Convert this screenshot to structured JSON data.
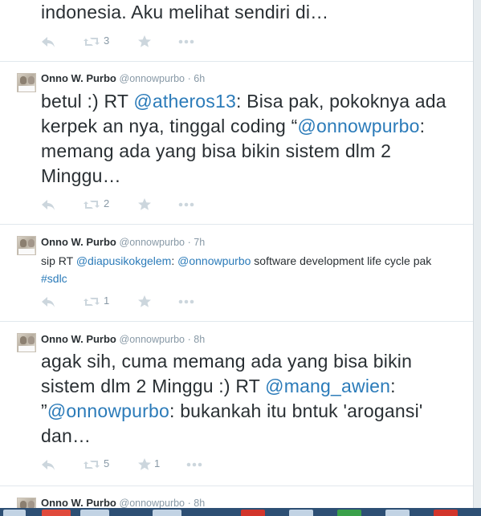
{
  "tweets": [
    {
      "text_segments": [
        {
          "text": "indonesia. Aku melihat sendiri di…",
          "link": false
        }
      ],
      "retweet_count": "3",
      "favorite_count": ""
    },
    {
      "name": "Onno W. Purbo",
      "handle": "@onnowpurbo",
      "time": "· 6h",
      "text_segments": [
        {
          "text": "betul :) RT ",
          "link": false
        },
        {
          "text": "@atheros13",
          "link": true
        },
        {
          "text": ": Bisa pak, pokoknya ada kerpek an nya, tinggal coding “",
          "link": false
        },
        {
          "text": "@onnowpurbo",
          "link": true
        },
        {
          "text": ": memang ada yang bisa bikin sistem dlm 2 Minggu…",
          "link": false
        }
      ],
      "retweet_count": "2",
      "favorite_count": ""
    },
    {
      "name": "Onno W. Purbo",
      "handle": "@onnowpurbo",
      "time": "· 7h",
      "text_segments": [
        {
          "text": "sip RT ",
          "link": false
        },
        {
          "text": "@diapusikokgelem",
          "link": true
        },
        {
          "text": ": ",
          "link": false
        },
        {
          "text": "@onnowpurbo",
          "link": true
        },
        {
          "text": " software development life cycle pak ",
          "link": false
        },
        {
          "text": "#sdlc",
          "link": true
        }
      ],
      "retweet_count": "1",
      "favorite_count": ""
    },
    {
      "name": "Onno W. Purbo",
      "handle": "@onnowpurbo",
      "time": "· 8h",
      "text_segments": [
        {
          "text": "agak sih, cuma memang ada yang bisa bikin sistem dlm 2 Minggu :) RT ",
          "link": false
        },
        {
          "text": "@mang_awien",
          "link": true
        },
        {
          "text": ": ”",
          "link": false
        },
        {
          "text": "@onnowpurbo",
          "link": true
        },
        {
          "text": ": bukankah itu bntuk 'arogansi' dan…",
          "link": false
        }
      ],
      "retweet_count": "5",
      "favorite_count": "1"
    },
    {
      "name": "Onno W. Purbo",
      "handle": "@onnowpurbo",
      "time": "· 8h"
    }
  ],
  "icons": {
    "reply": "reply-icon",
    "retweet": "retweet-icon",
    "favorite": "star-icon",
    "more": "more-icon"
  },
  "colors": {
    "link": "#2b7bb9",
    "icon": "#ccd6dd",
    "meta": "#8899a6",
    "text": "#292f33"
  }
}
